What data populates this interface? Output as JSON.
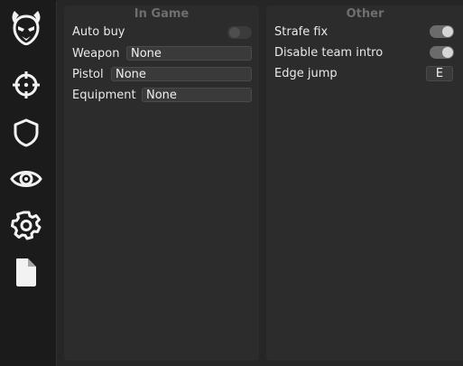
{
  "sidebar": {
    "icons": [
      "logo-demon-icon",
      "crosshair-icon",
      "shield-icon",
      "eye-icon",
      "gear-icon",
      "file-icon"
    ]
  },
  "in_game": {
    "title": "In Game",
    "auto_buy": {
      "label": "Auto buy",
      "enabled": false
    },
    "weapon": {
      "label": "Weapon",
      "value": "None"
    },
    "pistol": {
      "label": "Pistol",
      "value": "None"
    },
    "equipment": {
      "label": "Equipment",
      "value": "None"
    }
  },
  "other": {
    "title": "Other",
    "strafe_fix": {
      "label": "Strafe fix",
      "enabled": true
    },
    "disable_team_intro": {
      "label": "Disable team intro",
      "enabled": true
    },
    "edge_jump": {
      "label": "Edge jump",
      "key": "E"
    }
  },
  "colors": {
    "background": "#1b1b1b",
    "main": "#262626",
    "panel": "#2c2c2c",
    "field": "#3a3a3a",
    "title_text": "#6f6f6f",
    "text": "#e9e9e9"
  }
}
